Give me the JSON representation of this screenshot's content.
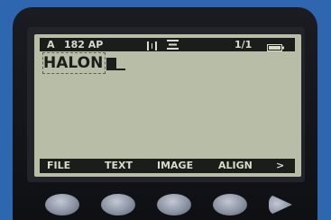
{
  "status": {
    "mode": "A",
    "tape_info": "182 AP",
    "page": "1/1"
  },
  "icons": {
    "grid": "grid-icon",
    "align": "align-lines-icon",
    "battery": "battery-icon"
  },
  "editor": {
    "text": "HALON"
  },
  "menu": {
    "file": "FILE",
    "text": "TEXT",
    "image": "IMAGE",
    "align": "ALIGN",
    "next": ">"
  },
  "colors": {
    "device_body": "#2f66b0",
    "lcd_background": "#b7bda6",
    "lcd_ink": "#1b1d1b"
  }
}
